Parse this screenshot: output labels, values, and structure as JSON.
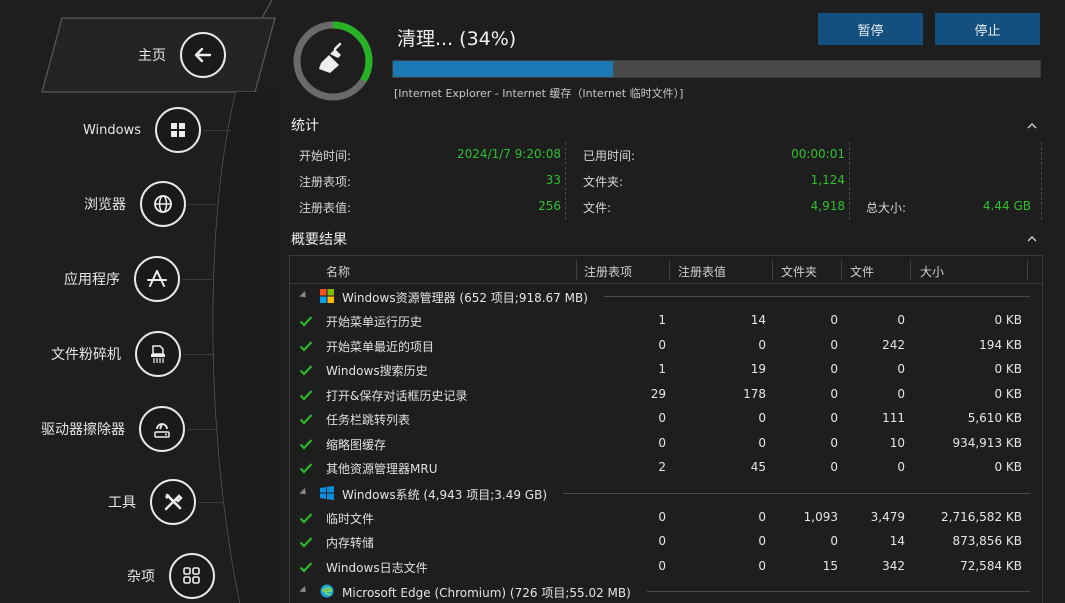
{
  "sidebar": {
    "items": [
      {
        "label": "主页",
        "icon": "back-arrow-icon"
      },
      {
        "label": "Windows",
        "icon": "windows-logo-icon"
      },
      {
        "label": "浏览器",
        "icon": "globe-icon"
      },
      {
        "label": "应用程序",
        "icon": "app-store-icon"
      },
      {
        "label": "文件粉碎机",
        "icon": "shredder-icon"
      },
      {
        "label": "驱动器擦除器",
        "icon": "drive-wipe-icon"
      },
      {
        "label": "工具",
        "icon": "tools-icon"
      },
      {
        "label": "杂项",
        "icon": "grid-icon"
      }
    ]
  },
  "status": {
    "title": "清理... (34%)",
    "progress_percent": 34,
    "current_item": "[Internet Explorer - Internet 缓存（Internet 临时文件）]",
    "pause_label": "暂停",
    "stop_label": "停止"
  },
  "stats": {
    "title": "统计",
    "start_time_label": "开始时间:",
    "start_time": "2024/1/7 9:20:08",
    "elapsed_label": "已用时间:",
    "elapsed": "00:00:01",
    "reg_keys_label": "注册表项:",
    "reg_keys": "33",
    "folders_label": "文件夹:",
    "folders": "1,124",
    "reg_values_label": "注册表值:",
    "reg_values": "256",
    "files_label": "文件:",
    "files": "4,918",
    "total_size_label": "总大小:",
    "total_size": "4.44 GB"
  },
  "results": {
    "title": "概要结果",
    "columns": [
      "名称",
      "注册表项",
      "注册表值",
      "文件夹",
      "文件",
      "大小"
    ],
    "groups": [
      {
        "label": "Windows资源管理器 (652 项目;918.67 MB)",
        "icon": "windows-color-icon",
        "rows": [
          {
            "name": "开始菜单运行历史",
            "reg_keys": "1",
            "reg_values": "14",
            "folders": "0",
            "files": "0",
            "size": "0 KB"
          },
          {
            "name": "开始菜单最近的项目",
            "reg_keys": "0",
            "reg_values": "0",
            "folders": "0",
            "files": "242",
            "size": "194 KB"
          },
          {
            "name": "Windows搜索历史",
            "reg_keys": "1",
            "reg_values": "19",
            "folders": "0",
            "files": "0",
            "size": "0 KB"
          },
          {
            "name": "打开&保存对话框历史记录",
            "reg_keys": "29",
            "reg_values": "178",
            "folders": "0",
            "files": "0",
            "size": "0 KB"
          },
          {
            "name": "任务栏跳转列表",
            "reg_keys": "0",
            "reg_values": "0",
            "folders": "0",
            "files": "111",
            "size": "5,610 KB"
          },
          {
            "name": "缩略图缓存",
            "reg_keys": "0",
            "reg_values": "0",
            "folders": "0",
            "files": "10",
            "size": "934,913 KB"
          },
          {
            "name": "其他资源管理器MRU",
            "reg_keys": "2",
            "reg_values": "45",
            "folders": "0",
            "files": "0",
            "size": "0 KB"
          }
        ]
      },
      {
        "label": "Windows系统 (4,943 项目;3.49 GB)",
        "icon": "windows-blue-icon",
        "rows": [
          {
            "name": "临时文件",
            "reg_keys": "0",
            "reg_values": "0",
            "folders": "1,093",
            "files": "3,479",
            "size": "2,716,582 KB"
          },
          {
            "name": "内存转储",
            "reg_keys": "0",
            "reg_values": "0",
            "folders": "0",
            "files": "14",
            "size": "873,856 KB"
          },
          {
            "name": "Windows日志文件",
            "reg_keys": "0",
            "reg_values": "0",
            "folders": "15",
            "files": "342",
            "size": "72,584 KB"
          }
        ]
      },
      {
        "label": "Microsoft Edge (Chromium) (726 项目;55.02 MB)",
        "icon": "edge-icon",
        "rows": []
      }
    ]
  },
  "colors": {
    "accent": "#1a79b4",
    "button": "#14507f",
    "value_green": "#2ec02e",
    "check_green": "#2db52d",
    "background": "#1e1e1e"
  }
}
